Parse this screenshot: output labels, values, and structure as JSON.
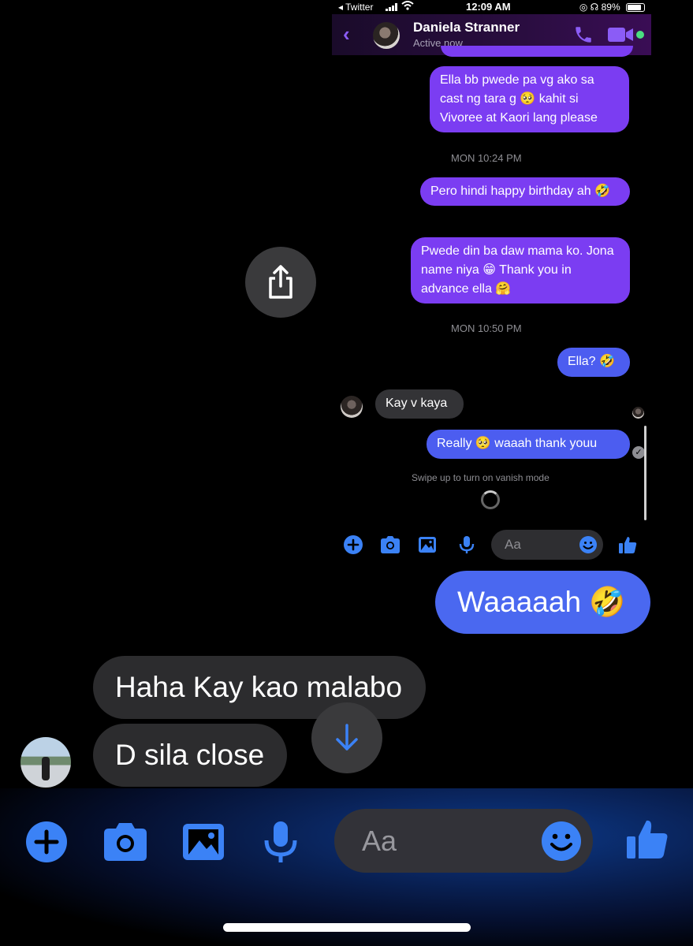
{
  "status_bar": {
    "back_app": "◂ Twitter",
    "time": "12:09 AM",
    "battery": "89%"
  },
  "chat_header": {
    "contact_name": "Daniela Stranner",
    "contact_status": "Active now"
  },
  "thread": {
    "messages": [
      {
        "id": "m1",
        "sender": "me",
        "text": "Ella bb pwede pa vg ako sa cast ng tara g 🥺 kahit si Vivoree at Kaori lang please"
      },
      {
        "id": "ts1",
        "type": "timestamp",
        "text": "MON 10:24 PM"
      },
      {
        "id": "m2",
        "sender": "me",
        "text": "Pero hindi happy birthday ah 🤣"
      },
      {
        "id": "m3",
        "sender": "me",
        "text": "Pwede din ba daw mama ko. Jona name niya 😁 Thank you in advance ella 🤗"
      },
      {
        "id": "ts2",
        "type": "timestamp",
        "text": "MON 10:50 PM"
      },
      {
        "id": "m4",
        "sender": "me",
        "text": "Ella? 🤣"
      },
      {
        "id": "m5",
        "sender": "them",
        "text": "Kay v kaya"
      },
      {
        "id": "m6",
        "sender": "me",
        "text": "Really 🥺 waaah thank youu"
      }
    ],
    "vanish_hint": "Swipe up to turn on vanish mode",
    "composer_placeholder": "Aa"
  },
  "outer_chat": {
    "messages": [
      {
        "id": "o1",
        "sender": "me",
        "text": "Waaaaah 🤣"
      },
      {
        "id": "o2",
        "sender": "them",
        "text": "Haha Kay kao malabo"
      },
      {
        "id": "o3",
        "sender": "them",
        "text": "D sila close"
      }
    ],
    "composer_placeholder": "Aa"
  },
  "colors": {
    "accent_blue": "#4a68f0",
    "accent_purple": "#7b3df2",
    "icon_blue": "#3b82f6"
  },
  "icons": [
    "share-icon",
    "scroll-down-arrow-icon",
    "plus-icon",
    "camera-icon",
    "gallery-icon",
    "microphone-icon",
    "emoji-icon",
    "thumbs-up-icon",
    "phone-icon",
    "video-icon",
    "back-chevron-icon"
  ]
}
